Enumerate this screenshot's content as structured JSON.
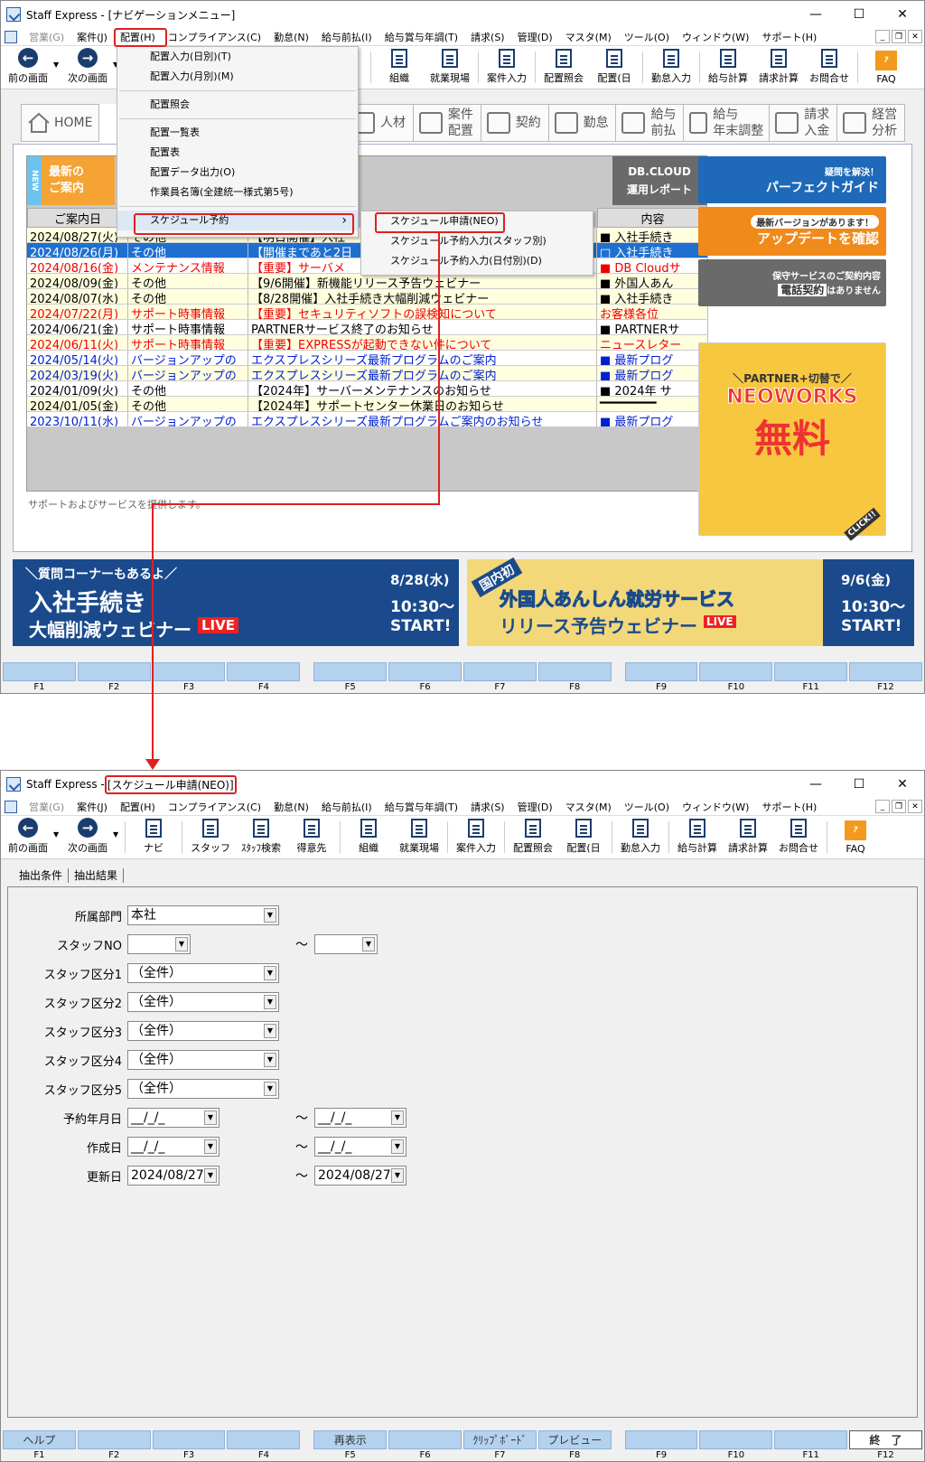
{
  "win1": {
    "title": "Staff Express - [ナビゲーションメニュー]",
    "menus": [
      "営業(G)",
      "案件(J)",
      "配置(H)",
      "コンプライアンス(C)",
      "勤怠(N)",
      "給与前払(I)",
      "給与賞与年調(T)",
      "請求(S)",
      "管理(D)",
      "マスタ(M)",
      "ツール(O)",
      "ウィンドウ(W)",
      "サポート(H)"
    ],
    "toolbar": [
      "前の画面",
      "次の画面",
      "組織",
      "就業現場",
      "案件入力",
      "配置照会",
      "配置(日",
      "勤怠入力",
      "給与計算",
      "請求計算",
      "お問合せ",
      "FAQ"
    ],
    "navtabs": [
      "HOME",
      "人材",
      "案件\n配置",
      "契約",
      "勤怠",
      "給与\n前払",
      "給与\n年末調整",
      "請求\n入金",
      "経営\n分析"
    ],
    "dropdown": {
      "items": [
        "配置入力(日別)(T)",
        "配置入力(月別)(M)",
        "配置照会",
        "配置一覧表",
        "配置表",
        "配置データ出力(O)",
        "作業員名簿(全建統一様式第5号)",
        "スケジュール予約"
      ],
      "submenu": [
        "スケジュール申請(NEO)",
        "スケジュール予約入力(スタッフ別)",
        "スケジュール予約入力(日付別)(D)"
      ]
    },
    "news": {
      "new_label": "NEW",
      "header_title1": "最新の",
      "header_title2": "ご案内",
      "dbcloud1": "DB.CLOUD",
      "dbcloud2": "運用レポート",
      "col_date": "ご案内日",
      "col_content": "内容",
      "rows": [
        {
          "d": "2024/08/27(火)",
          "c": "その他",
          "t": "【明日開催】入社",
          "n": "■ 入社手続き",
          "s": "y"
        },
        {
          "d": "2024/08/26(月)",
          "c": "その他",
          "t": "【開催まであと2日",
          "n": "□ 入社手続き",
          "s": "sel"
        },
        {
          "d": "2024/08/16(金)",
          "c": "メンテナンス情報",
          "t": "【重要】サーバメ",
          "n": "■ DB Cloudサ",
          "s": "red"
        },
        {
          "d": "2024/08/09(金)",
          "c": "その他",
          "t": "【9/6開催】新機能リリース予告ウェビナー",
          "n": "■ 外国人あん",
          "s": "y"
        },
        {
          "d": "2024/08/07(水)",
          "c": "その他",
          "t": "【8/28開催】入社手続き大幅削減ウェビナー",
          "n": "■ 入社手続き",
          "s": "y"
        },
        {
          "d": "2024/07/22(月)",
          "c": "サポート時事情報",
          "t": "【重要】セキュリティソフトの誤検知について",
          "n": "お客様各位",
          "s": "redy"
        },
        {
          "d": "2024/06/21(金)",
          "c": "サポート時事情報",
          "t": "PARTNERサービス終了のお知らせ",
          "n": "■ PARTNERサ",
          "s": ""
        },
        {
          "d": "2024/06/11(火)",
          "c": "サポート時事情報",
          "t": "【重要】EXPRESSが起動できない件について",
          "n": "ニュースレター",
          "s": "redy"
        },
        {
          "d": "2024/05/14(火)",
          "c": "バージョンアップの",
          "t": "エクスプレスシリーズ最新プログラムのご案内",
          "n": "■ 最新プログ",
          "s": "blue"
        },
        {
          "d": "2024/03/19(火)",
          "c": "バージョンアップの",
          "t": "エクスプレスシリーズ最新プログラムのご案内",
          "n": "■ 最新プログ",
          "s": "bluey"
        },
        {
          "d": "2024/01/09(火)",
          "c": "その他",
          "t": "【2024年】サーバーメンテナンスのお知らせ",
          "n": "■ 2024年 サ",
          "s": ""
        },
        {
          "d": "2024/01/05(金)",
          "c": "その他",
          "t": "【2024年】サポートセンター休業日のお知らせ",
          "n": "━━━━━━━━",
          "s": "y"
        },
        {
          "d": "2023/10/11(水)",
          "c": "バージョンアップの",
          "t": "エクスプレスシリーズ最新プログラムご案内のお知らせ",
          "n": "■ 最新プログ",
          "s": "blue"
        }
      ],
      "footnote": "サポートおよびサービスを提供します。"
    },
    "ads": {
      "guide1": "疑問を解決！",
      "guide2": "パーフェクトガイド",
      "update1": "最新バージョンがあります！",
      "update2": "アップデートを確認",
      "support1": "保守サービスのご契約内容",
      "support2a": "電話契約",
      "support2b": "はありません",
      "neo1": "＼PARTNER+切替で／",
      "neo2": "NEOWORKS",
      "neo3": "無料",
      "neo4": "CLICK!!"
    },
    "banners": {
      "b1_top": "＼質問コーナーもあるよ／",
      "b1_l1": "入社手続き",
      "b1_l2": "大幅削減ウェビナー",
      "b1_live": "LIVE",
      "b1_date": "8/28(水)",
      "b1_time": "10:30～",
      "b1_start": "START!",
      "b2_tag": "国内初",
      "b2_l1": "外国人あんしん就労サービス",
      "b2_l2": "リリース予告ウェビナー",
      "b2_live": "LIVE",
      "b2_date": "9/6(金)",
      "b2_time": "10:30～",
      "b2_start": "START!"
    },
    "fkeys": [
      "F1",
      "F2",
      "F3",
      "F4",
      "F5",
      "F6",
      "F7",
      "F8",
      "F9",
      "F10",
      "F11",
      "F12"
    ]
  },
  "win2": {
    "title_prefix": "Staff Express - ",
    "title_hl": "[スケジュール申請(NEO)]",
    "toolbar": [
      "前の画面",
      "次の画面",
      "ナビ",
      "スタッフ",
      "ｽﾀｯﾌ検索",
      "得意先",
      "組織",
      "就業現場",
      "案件入力",
      "配置照会",
      "配置(日",
      "勤怠入力",
      "給与計算",
      "請求計算",
      "お問合せ",
      "FAQ"
    ],
    "tabs": [
      "抽出条件",
      "抽出結果"
    ],
    "fields": [
      {
        "label": "所属部門",
        "v1": "本社"
      },
      {
        "label": "スタッフNO",
        "v1": "",
        "v2": ""
      },
      {
        "label": "スタッフ区分1",
        "v1": "（全件）"
      },
      {
        "label": "スタッフ区分2",
        "v1": "（全件）"
      },
      {
        "label": "スタッフ区分3",
        "v1": "（全件）"
      },
      {
        "label": "スタッフ区分4",
        "v1": "（全件）"
      },
      {
        "label": "スタッフ区分5",
        "v1": "（全件）"
      },
      {
        "label": "予約年月日",
        "v1": "__/_/_",
        "v2": "__/_/_"
      },
      {
        "label": "作成日",
        "v1": "__/_/_",
        "v2": "__/_/_"
      },
      {
        "label": "更新日",
        "v1": "2024/08/27",
        "v2": "2024/08/27"
      }
    ],
    "tilde": "～",
    "fkeys": [
      {
        "k": "F1",
        "l": "ヘルプ"
      },
      {
        "k": "F2",
        "l": ""
      },
      {
        "k": "F3",
        "l": ""
      },
      {
        "k": "F4",
        "l": ""
      },
      {
        "k": "F5",
        "l": "再表示"
      },
      {
        "k": "F6",
        "l": ""
      },
      {
        "k": "F7",
        "l": "ｸﾘｯﾌﾟﾎﾞｰﾄﾞ"
      },
      {
        "k": "F8",
        "l": "プレビュー"
      },
      {
        "k": "F9",
        "l": ""
      },
      {
        "k": "F10",
        "l": ""
      },
      {
        "k": "F11",
        "l": ""
      },
      {
        "k": "F12",
        "l": "終　了"
      }
    ]
  },
  "colors": {
    "accent": "#e02020",
    "selection": "#1e6fd0",
    "fkey": "#b4d2ee",
    "orange": "#f5a332",
    "navy": "#1a3d6e"
  }
}
